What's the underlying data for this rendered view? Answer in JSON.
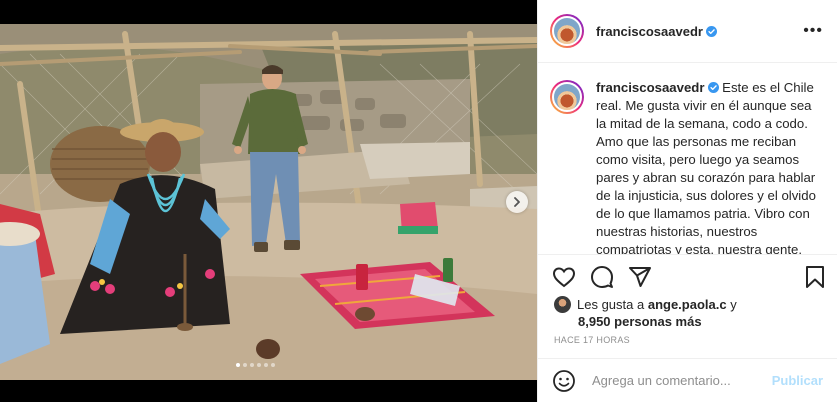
{
  "post": {
    "username": "franciscosaavedr",
    "caption": "Este es el Chile real. Me gusta vivir en él aunque sea la mitad de la semana, codo a codo. Amo que las personas me reciban como visita, pero luego ya seamos pares y abran su corazón para hablar de la injusticia, sus dolores y el olvido de lo que llamamos patria. Vibro con nuestras historias, nuestros compatriotas y esta, nuestra gente.",
    "likes_prefix": "Les gusta a",
    "liked_by": "ange.paola.c",
    "likes_and": "y",
    "likes_others": "8,950 personas más",
    "timestamp": "HACE 17 HORAS"
  },
  "carousel": {
    "dots": 6,
    "active": 1
  },
  "comment": {
    "placeholder": "Agrega un comentario...",
    "publish_label": "Publicar"
  },
  "colors": {
    "verified": "#3897f0",
    "publish_disabled": "#b2dffc",
    "muted": "#8e8e8e"
  },
  "icons": [
    "more-icon",
    "heart-icon",
    "comment-icon",
    "share-icon",
    "bookmark-icon",
    "emoji-icon",
    "chevron-right-icon",
    "verified-icon"
  ]
}
